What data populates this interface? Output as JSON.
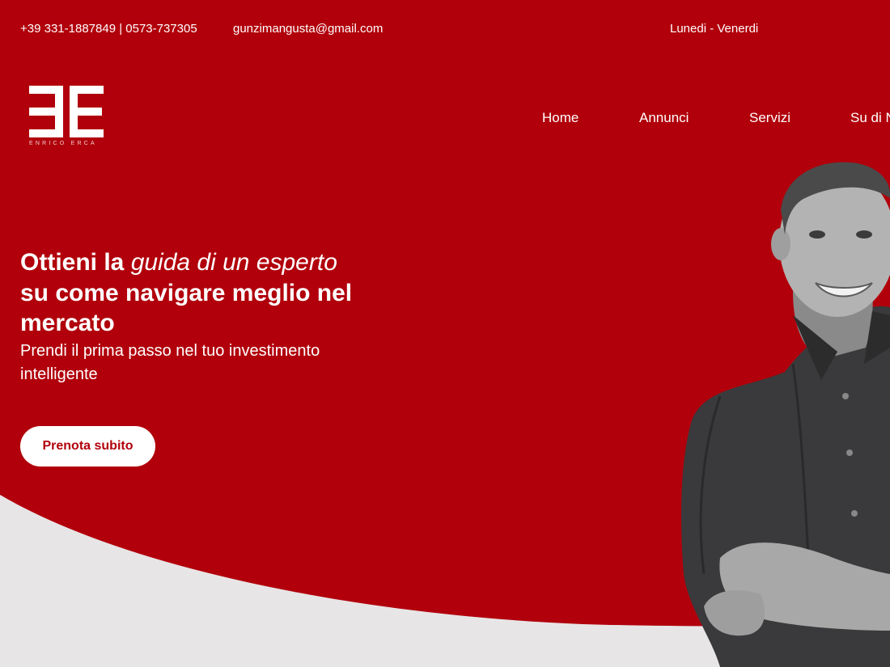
{
  "colors": {
    "primary_red": "#b1000b",
    "light_gray": "#e8e5e6",
    "white": "#ffffff"
  },
  "topbar": {
    "phone": "+39 331-1887849 | 0573-737305",
    "email": "gunzimangusta@gmail.com",
    "hours": "Lunedi - Venerdi"
  },
  "logo": {
    "monogram": "EE",
    "brand_name": "ENRICO ERCA"
  },
  "nav": {
    "home": "Home",
    "annunci": "Annunci",
    "servizi": "Servizi",
    "about": "Su di N"
  },
  "hero": {
    "headline_part1": "Ottieni la ",
    "headline_italic": "guida di un esperto",
    "headline_part2": "su come navigare meglio nel mercato",
    "subheadline": "Prendi il prima passo nel tuo investimento intelligente",
    "cta_label": "Prenota subito"
  }
}
